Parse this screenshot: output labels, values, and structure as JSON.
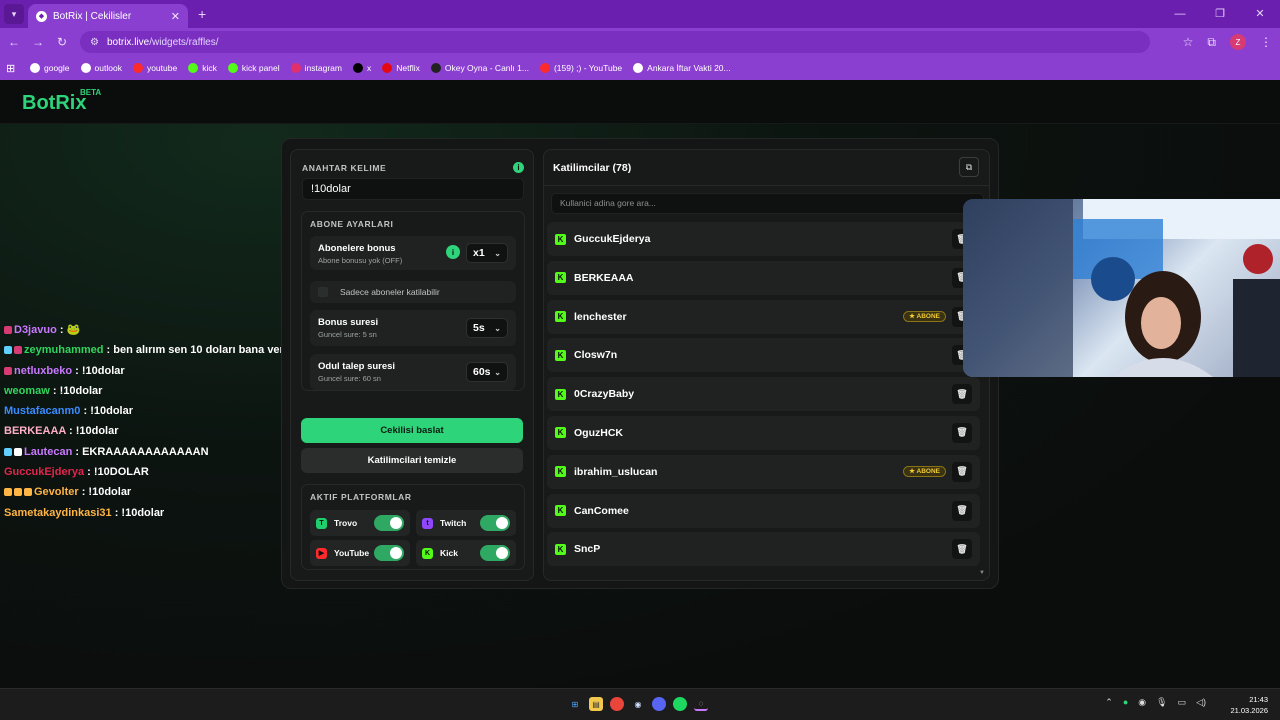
{
  "browser": {
    "tab_title": "BotRix | Cekilisler",
    "url_host": "botrix.live",
    "url_path": "/widgets/raffles/",
    "profile_initial": "Z",
    "bookmarks": [
      {
        "label": "google",
        "icon": "google-icon",
        "color": "#ffffff"
      },
      {
        "label": "outlook",
        "icon": "globe-icon",
        "color": "#ffffff"
      },
      {
        "label": "youtube",
        "icon": "youtube-icon",
        "color": "#ff2a2a"
      },
      {
        "label": "kick",
        "icon": "kick-icon",
        "color": "#53fc18"
      },
      {
        "label": "kick panel",
        "icon": "kick-icon",
        "color": "#53fc18"
      },
      {
        "label": "instagram",
        "icon": "instagram-icon",
        "color": "#e1306c"
      },
      {
        "label": "x",
        "icon": "x-icon",
        "color": "#000000"
      },
      {
        "label": "Netflix",
        "icon": "netflix-icon",
        "color": "#e50914"
      },
      {
        "label": "Okey Oyna - Canlı 1...",
        "icon": "okey-icon",
        "color": "#222222"
      },
      {
        "label": "(159) ;) - YouTube",
        "icon": "youtube-icon",
        "color": "#ff2a2a"
      },
      {
        "label": "Ankara İftar Vakti 20...",
        "icon": "site-icon",
        "color": "#ffffff"
      }
    ]
  },
  "site": {
    "logo": "BotRix",
    "logo_badge": "BETA"
  },
  "chat": [
    {
      "user": "D3javuo",
      "user_color": "#c979ff",
      "message": "",
      "badges": [
        "#d63b73"
      ]
    },
    {
      "user": "zeymuhammed",
      "user_color": "#31d45c",
      "message": "ben alırım sen 10 doları bana ver",
      "badges": [
        "#5fd0ff",
        "#d63b73"
      ]
    },
    {
      "user": "netluxbeko",
      "user_color": "#c979ff",
      "message": "!10dolar",
      "badges": [
        "#d63b73"
      ]
    },
    {
      "user": "weomaw",
      "user_color": "#31d45c",
      "message": "!10dolar",
      "badges": []
    },
    {
      "user": "Mustafacanm0",
      "user_color": "#3b8bff",
      "message": "!10dolar",
      "badges": []
    },
    {
      "user": "BERKEAAA",
      "user_color": "#ffb0c8",
      "message": "!10dolar",
      "badges": []
    },
    {
      "user": "Lautecan",
      "user_color": "#c979ff",
      "message": "EKRAAAAAAAAAAAAN",
      "badges": [
        "#5fd0ff",
        "#ffffff"
      ]
    },
    {
      "user": "GuccukEjderya",
      "user_color": "#e0264d",
      "message": "!10DOLAR",
      "badges": []
    },
    {
      "user": "Gevolter",
      "user_color": "#ffb545",
      "message": "!10dolar",
      "badges": [
        "#ffb545",
        "#ffb545",
        "#ffb545"
      ]
    },
    {
      "user": "Sametakaydinkasi31",
      "user_color": "#ffb545",
      "message": "!10dolar",
      "badges": []
    }
  ],
  "settings": {
    "keyword_label": "ANAHTAR KELIME",
    "keyword_value": "!10dolar",
    "sub_section_label": "ABONE AYARLARI",
    "sub_bonus": {
      "title": "Abonelere bonus",
      "subtitle": "Abone bonusu yok (OFF)",
      "value": "x1"
    },
    "subs_only_label": "Sadece aboneler katilabilir",
    "bonus_duration": {
      "title": "Bonus suresi",
      "subtitle": "Guncel sure: 5 sn",
      "value": "5s"
    },
    "claim_duration": {
      "title": "Odul talep suresi",
      "subtitle": "Guncel sure: 60 sn",
      "value": "60s"
    },
    "start_button": "Cekilisi baslat",
    "clear_button": "Katilimcilari temizle",
    "platforms_label": "AKTIF PLATFORMLAR",
    "platforms": [
      {
        "name": "Trovo",
        "enabled": true,
        "icon": "trovo-icon",
        "color": "#1fcf6e"
      },
      {
        "name": "Twitch",
        "enabled": true,
        "icon": "twitch-icon",
        "color": "#9146ff"
      },
      {
        "name": "YouTube",
        "enabled": true,
        "icon": "youtube-icon",
        "color": "#ff2a2a"
      },
      {
        "name": "Kick",
        "enabled": true,
        "icon": "kick-icon",
        "color": "#53fc18"
      }
    ]
  },
  "participants": {
    "title": "Katilimcilar (78)",
    "search_placeholder": "Kullanici adina gore ara...",
    "list": [
      {
        "name": "GuccukEjderya",
        "abone": false
      },
      {
        "name": "BERKEAAA",
        "abone": false
      },
      {
        "name": "lenchester",
        "abone": true
      },
      {
        "name": "Closw7n",
        "abone": false
      },
      {
        "name": "0CrazyBaby",
        "abone": false
      },
      {
        "name": "OguzHCK",
        "abone": false
      },
      {
        "name": "ibrahim_uslucan",
        "abone": true
      },
      {
        "name": "CanComee",
        "abone": false
      },
      {
        "name": "SncP",
        "abone": false
      }
    ],
    "abone_label": "ABONE"
  },
  "taskbar": {
    "time": "21:43",
    "date": "21.03.2026"
  }
}
